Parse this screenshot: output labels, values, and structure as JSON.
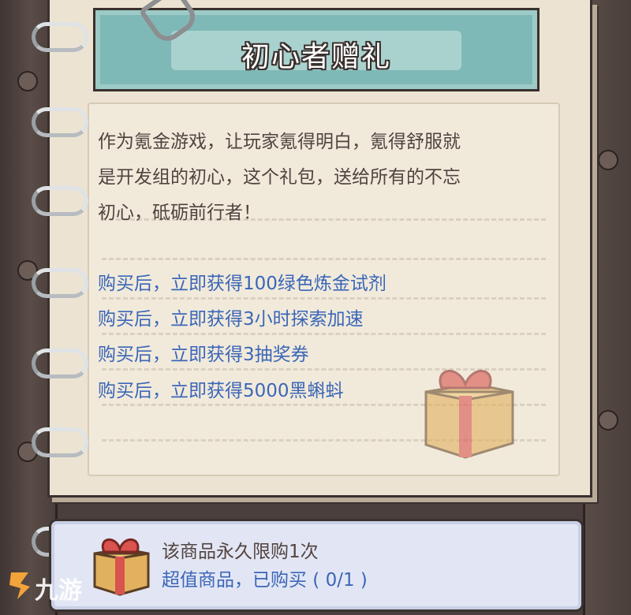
{
  "title": "初心者赠礼",
  "description": [
    "作为氪金游戏，让玩家氪得明白，氪得舒服就",
    "是开发组的初心，这个礼包，送给所有的不忘",
    "初心，砥砺前行者！"
  ],
  "benefits": [
    "购买后，立即获得100绿色炼金试剂",
    "购买后，立即获得3小时探索加速",
    "购买后，立即获得3抽奖券",
    "购买后，立即获得5000黑蝌蚪"
  ],
  "purchase": {
    "limit": "该商品永久限购1次",
    "status": "超值商品，已购买 ( 0/1 )"
  },
  "watermark": "九游",
  "colors": {
    "banner": "#7fb9b7",
    "benefit_text": "#3b66b8",
    "body_text": "#524340",
    "page": "#ece3d2"
  },
  "icons": [
    "gift-box-icon",
    "paper-clip-icon",
    "binder-ring-icon"
  ]
}
